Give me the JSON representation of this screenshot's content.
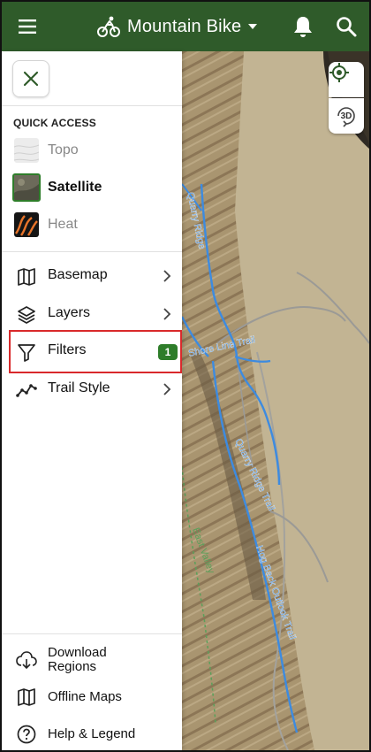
{
  "appbar": {
    "title": "Mountain Bike",
    "colors": {
      "background": "#2f5b2a"
    },
    "icons": [
      "menu-icon",
      "bike-icon",
      "caret-down-icon",
      "bell-icon",
      "search-icon"
    ]
  },
  "map": {
    "controls": {
      "three_d_label": "3D"
    },
    "trail_labels": {
      "quarry_ridge": "Quarry Ridge",
      "shore_line": "Shore Line Trail",
      "quarry_ridge_2": "Quarry Ridge",
      "hog_back": "Hog Back Outlook Trail",
      "east_valley": "East Valley",
      "quarry_ridge_trail": "Quarry Ridge Trail"
    }
  },
  "drawer": {
    "quick_access_heading": "QUICK ACCESS",
    "quick_access": [
      {
        "label": "Topo"
      },
      {
        "label": "Satellite"
      },
      {
        "label": "Heat"
      }
    ],
    "nav": [
      {
        "label": "Basemap"
      },
      {
        "label": "Layers"
      },
      {
        "label": "Filters",
        "badge": "1"
      },
      {
        "label": "Trail Style"
      }
    ],
    "bottom": [
      {
        "label": "Download Regions"
      },
      {
        "label": "Offline Maps"
      },
      {
        "label": "Help & Legend"
      }
    ]
  }
}
